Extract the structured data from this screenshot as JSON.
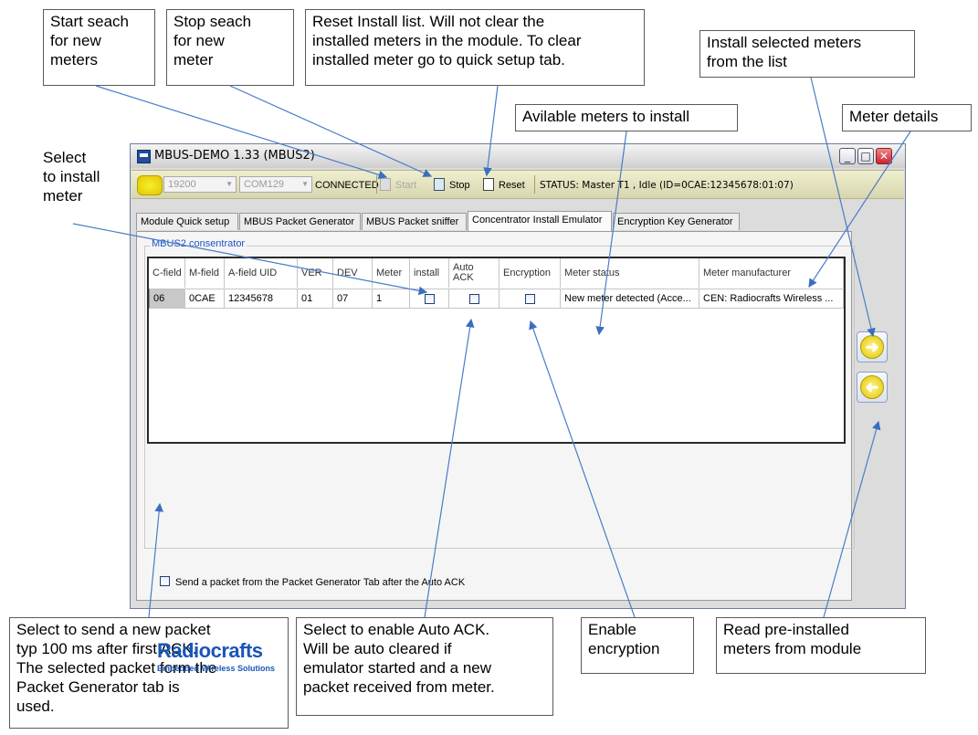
{
  "callouts": {
    "start": "Start seach\nfor new\nmeters",
    "stop": "Stop seach\nfor new\nmeter",
    "reset": "Reset Install list. Will not clear the\ninstalled meters in the module. To clear\ninstalled meter go to quick setup tab.",
    "install_selected": "Install selected meters\nfrom  the list",
    "available": "Avilable meters to install",
    "details": "Meter details",
    "select_install": "Select\nto install\nmeter",
    "send_packet": "Select to send a new packet\ntyp 100 ms after first ACK.\nThe selected packet form the\nPacket Generator tab is\nused.",
    "auto_ack": "Select to enable Auto ACK.\nWill be auto cleared if\nemulator started and a new\npacket received from meter.",
    "encryption": "Enable\nencryption",
    "read_preinstalled": "Read pre-installed\nmeters from module"
  },
  "window": {
    "title": "MBUS-DEMO 1.33 (MBUS2)",
    "minimize": "_",
    "maximize": "□",
    "close": "✕"
  },
  "toolbar": {
    "baud": "19200",
    "port": "COM129",
    "connection": "CONNECTED",
    "start": "Start",
    "stop": "Stop",
    "reset": "Reset",
    "status": "STATUS: Master T1 , Idle  (ID=0CAE:12345678:01:07)"
  },
  "tabs": [
    "Module Quick setup",
    "MBUS Packet Generator",
    "MBUS Packet sniffer",
    "Concentrator Install Emulator",
    "Encryption Key Generator"
  ],
  "group_label": "MBUS2 consentrator",
  "grid": {
    "headers": [
      "C-field",
      "M-field",
      "A-field UID",
      "VER",
      "DEV",
      "Meter",
      "install",
      "Auto\nACK",
      "Encryption",
      "Meter status",
      "Meter manufacturer"
    ],
    "row": [
      "06",
      "0CAE",
      "12345678",
      "01",
      "07",
      "1",
      "",
      "",
      "",
      "New meter detected (Acce...",
      "CEN: Radiocrafts Wireless ..."
    ]
  },
  "send_label": "Send a packet from the Packet Generator Tab after the Auto ACK",
  "logo": {
    "name": "Radiocrafts",
    "tagline": "Embedded Wireless Solutions"
  },
  "nav": {
    "install_icon": "arrow-right-icon",
    "read_icon": "arrow-left-icon"
  }
}
